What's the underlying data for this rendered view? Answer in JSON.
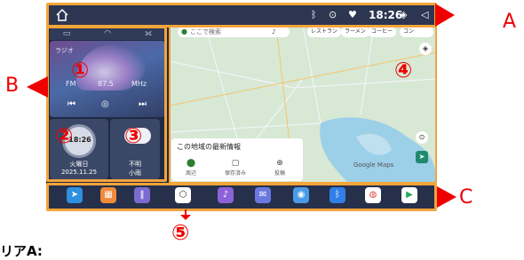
{
  "status_bar": {
    "time": "18:26"
  },
  "media": {
    "freq": "87.5",
    "unit": "MHz",
    "band": "FM",
    "tag": "ラジオ"
  },
  "clock_widget": {
    "time": "18:26",
    "weekday": "火曜日",
    "date": "2025.11.25"
  },
  "weather_widget": {
    "line1": "不明",
    "line2": "小雨"
  },
  "map": {
    "search_placeholder": "ここで検索",
    "chips": [
      "レストラン",
      "ラーメン",
      "コーヒー",
      "コン"
    ],
    "info_title": "この地域の最新情報",
    "actions": [
      "周辺",
      "保存済み",
      "投稿"
    ],
    "attribution": "Google Maps"
  },
  "annotations": {
    "letters": {
      "a": "A",
      "b": "B",
      "c": "C"
    },
    "numbers": {
      "n1": "①",
      "n2": "②",
      "n3": "③",
      "n4": "④",
      "n5": "⑤"
    },
    "bottom_text": "リアA:"
  },
  "colors": {
    "frame": "#f3a43a",
    "annotation": "#ee0000",
    "screen_bg": "#1e2a44"
  }
}
